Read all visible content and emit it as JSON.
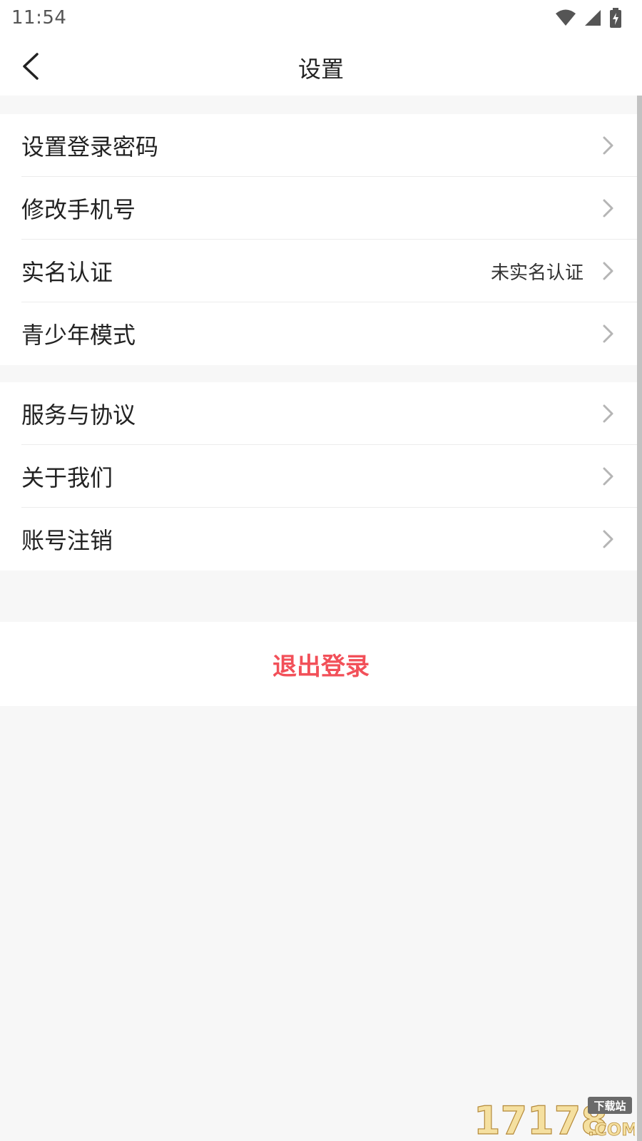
{
  "status_bar": {
    "time": "11:54",
    "icons": [
      "wifi-icon",
      "signal-icon",
      "battery-charging-icon"
    ]
  },
  "header": {
    "title": "设置",
    "back_icon": "chevron-left-icon"
  },
  "groups": [
    {
      "items": [
        {
          "label": "设置登录密码",
          "value": ""
        },
        {
          "label": "修改手机号",
          "value": ""
        },
        {
          "label": "实名认证",
          "value": "未实名认证"
        },
        {
          "label": "青少年模式",
          "value": ""
        }
      ]
    },
    {
      "items": [
        {
          "label": "服务与协议",
          "value": ""
        },
        {
          "label": "关于我们",
          "value": ""
        },
        {
          "label": "账号注销",
          "value": ""
        }
      ]
    }
  ],
  "logout": {
    "label": "退出登录",
    "color": "#f25059"
  },
  "colors": {
    "background": "#f7f7f7",
    "surface": "#ffffff",
    "chevron": "#b5b5b5",
    "watermark_accent": "#f5e0a0"
  },
  "watermark": {
    "logo_text": "17178",
    "sub_text": "下载站",
    "domain_text": ".COM"
  }
}
